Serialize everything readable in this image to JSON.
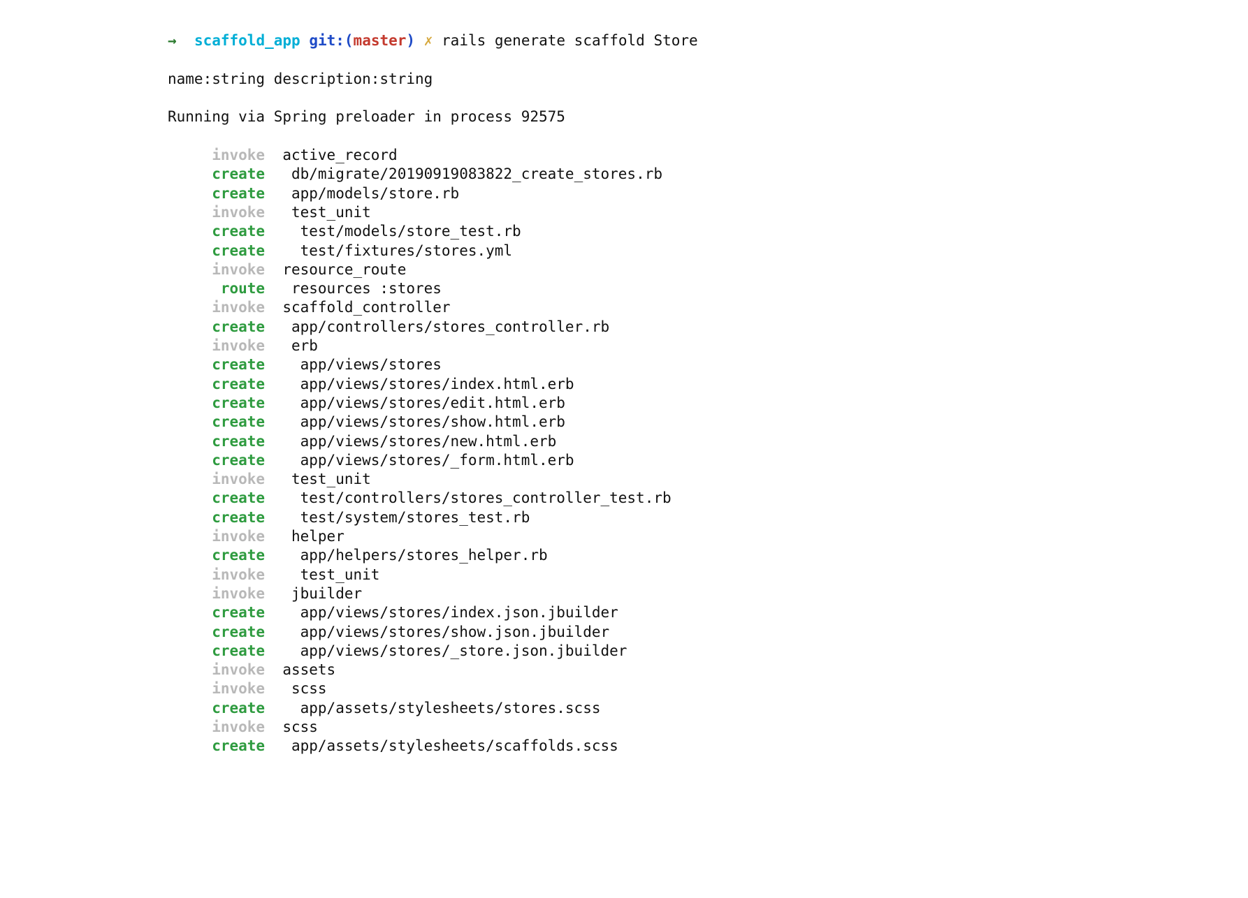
{
  "prompt": {
    "arrow": "→",
    "dir": "scaffold_app",
    "git_label": "git:(",
    "branch": "master",
    "git_close": ")",
    "dirty": "✗",
    "command": "rails generate scaffold Store",
    "command_line2": "name:string description:string"
  },
  "running": "Running via Spring preloader in process 92575",
  "lines": [
    {
      "action": "invoke",
      "path": "active_record",
      "indent": 0
    },
    {
      "action": "create",
      "path": "db/migrate/20190919083822_create_stores.rb",
      "indent": 1
    },
    {
      "action": "create",
      "path": "app/models/store.rb",
      "indent": 1
    },
    {
      "action": "invoke",
      "path": "test_unit",
      "indent": 1
    },
    {
      "action": "create",
      "path": "test/models/store_test.rb",
      "indent": 2
    },
    {
      "action": "create",
      "path": "test/fixtures/stores.yml",
      "indent": 2
    },
    {
      "action": "invoke",
      "path": "resource_route",
      "indent": 0
    },
    {
      "action": "route",
      "path": "resources :stores",
      "indent": 1
    },
    {
      "action": "invoke",
      "path": "scaffold_controller",
      "indent": 0
    },
    {
      "action": "create",
      "path": "app/controllers/stores_controller.rb",
      "indent": 1
    },
    {
      "action": "invoke",
      "path": "erb",
      "indent": 1
    },
    {
      "action": "create",
      "path": "app/views/stores",
      "indent": 2
    },
    {
      "action": "create",
      "path": "app/views/stores/index.html.erb",
      "indent": 2
    },
    {
      "action": "create",
      "path": "app/views/stores/edit.html.erb",
      "indent": 2
    },
    {
      "action": "create",
      "path": "app/views/stores/show.html.erb",
      "indent": 2
    },
    {
      "action": "create",
      "path": "app/views/stores/new.html.erb",
      "indent": 2
    },
    {
      "action": "create",
      "path": "app/views/stores/_form.html.erb",
      "indent": 2
    },
    {
      "action": "invoke",
      "path": "test_unit",
      "indent": 1
    },
    {
      "action": "create",
      "path": "test/controllers/stores_controller_test.rb",
      "indent": 2
    },
    {
      "action": "create",
      "path": "test/system/stores_test.rb",
      "indent": 2
    },
    {
      "action": "invoke",
      "path": "helper",
      "indent": 1
    },
    {
      "action": "create",
      "path": "app/helpers/stores_helper.rb",
      "indent": 2
    },
    {
      "action": "invoke",
      "path": "test_unit",
      "indent": 2
    },
    {
      "action": "invoke",
      "path": "jbuilder",
      "indent": 1
    },
    {
      "action": "create",
      "path": "app/views/stores/index.json.jbuilder",
      "indent": 2
    },
    {
      "action": "create",
      "path": "app/views/stores/show.json.jbuilder",
      "indent": 2
    },
    {
      "action": "create",
      "path": "app/views/stores/_store.json.jbuilder",
      "indent": 2
    },
    {
      "action": "invoke",
      "path": "assets",
      "indent": 0
    },
    {
      "action": "invoke",
      "path": "scss",
      "indent": 1
    },
    {
      "action": "create",
      "path": "app/assets/stylesheets/stores.scss",
      "indent": 2
    },
    {
      "action": "invoke",
      "path": "scss",
      "indent": 0
    },
    {
      "action": "create",
      "path": "app/assets/stylesheets/scaffolds.scss",
      "indent": 1
    }
  ]
}
